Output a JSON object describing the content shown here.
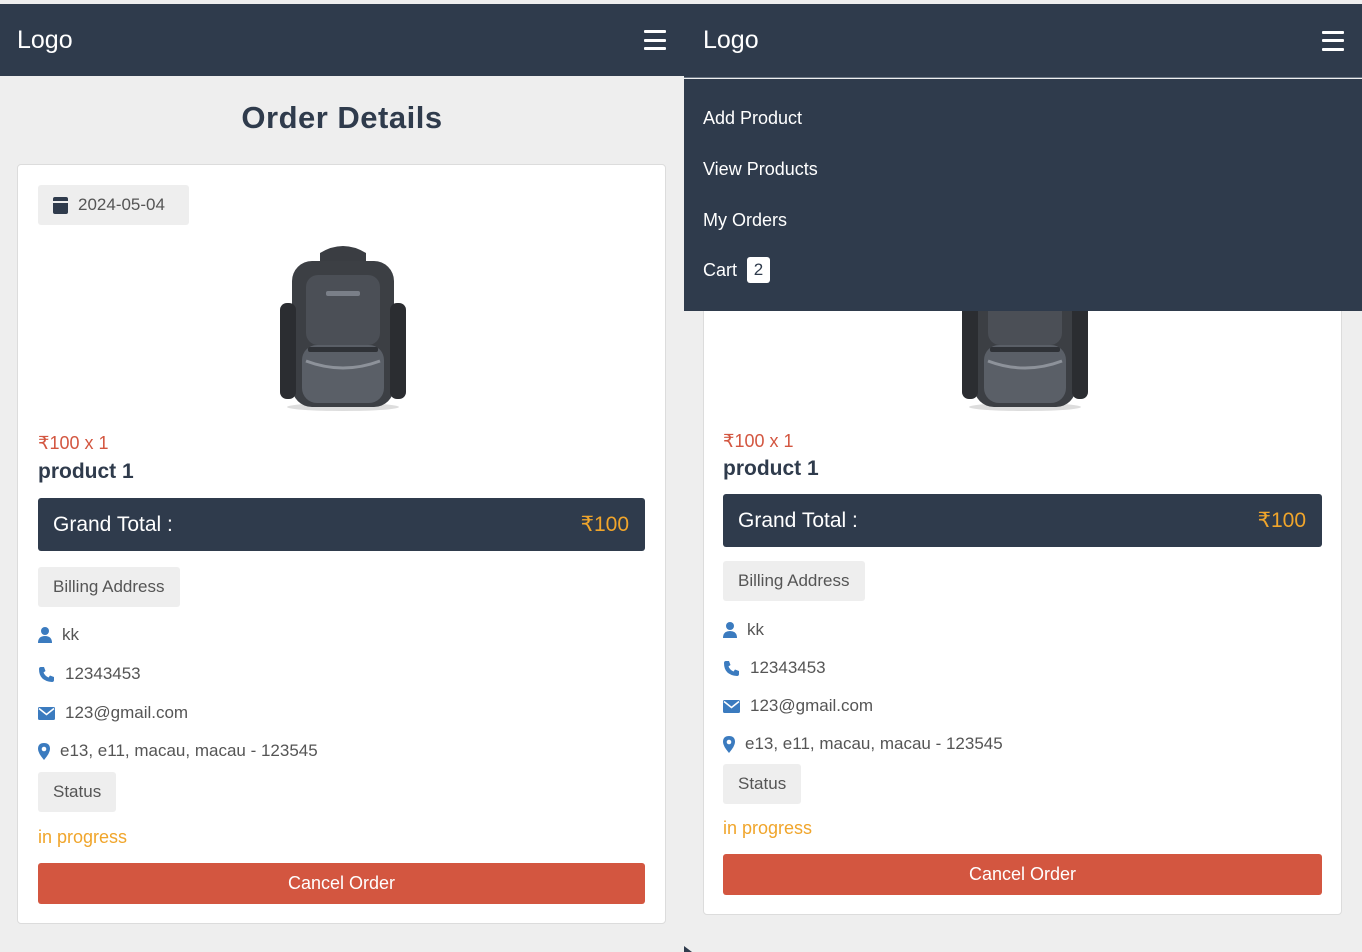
{
  "navbar": {
    "logo": "Logo"
  },
  "page": {
    "title": "Order Details"
  },
  "order": {
    "date": "2024-05-04",
    "price_line": "₹100 x 1",
    "product_name": "product 1",
    "grand_total_label": "Grand Total :",
    "grand_total_amount": "₹100",
    "billing_label": "Billing Address",
    "name": "kk",
    "phone": "12343453",
    "email": "123@gmail.com",
    "address": "e13, e11, macau, macau - 123545",
    "status_label": "Status",
    "status_value": "in progress",
    "cancel_label": "Cancel Order"
  },
  "menu": {
    "add_product": "Add Product",
    "view_products": "View Products",
    "my_orders": "My Orders",
    "cart": "Cart",
    "cart_count": "2"
  },
  "colors": {
    "navbar": "#2f3b4c",
    "price": "#d35640",
    "accent_orange": "#f0a52b",
    "icon_blue": "#3b7bbf"
  },
  "icons": [
    "menu-icon",
    "calendar-icon",
    "user-icon",
    "phone-icon",
    "envelope-icon",
    "map-marker-icon"
  ]
}
